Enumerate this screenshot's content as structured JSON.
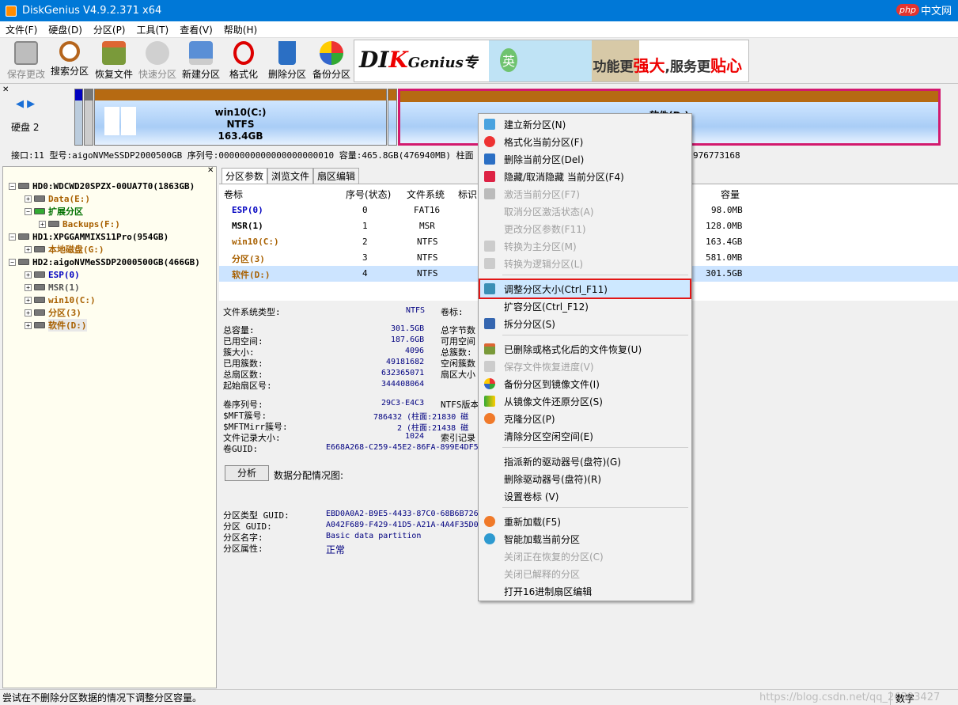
{
  "window": {
    "title": "DiskGenius V4.9.2.371 x64"
  },
  "watermark": {
    "php": "php",
    "cn": "中文网",
    "csdn": "https://blog.csdn.net/qq_26393427"
  },
  "menu": [
    "文件(F)",
    "硬盘(D)",
    "分区(P)",
    "工具(T)",
    "查看(V)",
    "帮助(H)"
  ],
  "toolbar": {
    "save": "保存更改",
    "search": "搜索分区",
    "recover": "恢复文件",
    "quick": "快速分区",
    "new": "新建分区",
    "format": "格式化",
    "delete": "删除分区",
    "backup": "备份分区"
  },
  "banner": {
    "logo_a": "DI",
    "logo_b": "K",
    "logo_c": "Genius",
    "logo_d": "专",
    "slogan_a": "功能更",
    "slogan_b": "强大",
    "slogan_c": ",服务更",
    "slogan_d": "贴心",
    "mascot": "英"
  },
  "diskbar": {
    "disk_label": "硬盘 2",
    "c_name": "win10(C:)",
    "c_fs": "NTFS",
    "c_size": "163.4GB",
    "d_name": "软件(D:)"
  },
  "infoline": "接口:11  型号:aigoNVMeSSDP2000500GB  序列号:0000000000000000000010  容量:465.8GB(476940MB)  柱面",
  "infoline_tail": "976773168",
  "tree": [
    {
      "label": "HD0:WDCWD20SPZX-00UA7T0(1863GB)",
      "cls": "c-disk"
    },
    {
      "label": "Data(E:)",
      "cls": "c-orange"
    },
    {
      "label": "扩展分区",
      "cls": "c-green"
    },
    {
      "label": "Backups(F:)",
      "cls": "c-orange"
    },
    {
      "label": "HD1:XPGGAMMIXS11Pro(954GB)",
      "cls": "c-disk"
    },
    {
      "label": "本地磁盘(G:)",
      "cls": "c-orange"
    },
    {
      "label": "HD2:aigoNVMeSSDP2000500GB(466GB)",
      "cls": "c-disk"
    },
    {
      "label": "ESP(0)",
      "cls": "c-blue"
    },
    {
      "label": "MSR(1)",
      "cls": "c-gray"
    },
    {
      "label": "win10(C:)",
      "cls": "c-orange"
    },
    {
      "label": "分区(3)",
      "cls": "c-orange"
    },
    {
      "label": "软件(D:)",
      "cls": "c-orange"
    }
  ],
  "tabs": [
    "分区参数",
    "浏览文件",
    "扇区编辑"
  ],
  "table": {
    "headers": [
      "卷标",
      "序号(状态)",
      "文件系统",
      "标识",
      "容量"
    ],
    "rows": [
      {
        "name": "ESP(0)",
        "idx": "0",
        "fs": "FAT16",
        "size": "98.0MB"
      },
      {
        "name": "MSR(1)",
        "idx": "1",
        "fs": "MSR",
        "size": "128.0MB"
      },
      {
        "name": "win10(C:)",
        "idx": "2",
        "fs": "NTFS",
        "size": "163.4GB"
      },
      {
        "name": "分区(3)",
        "idx": "3",
        "fs": "NTFS",
        "size": "581.0MB"
      },
      {
        "name": "软件(D:)",
        "idx": "4",
        "fs": "NTFS",
        "size": "301.5GB"
      }
    ]
  },
  "details": {
    "fs_type_label": "文件系统类型:",
    "fs_type": "NTFS",
    "vol_label": "卷标:",
    "total_label": "总容量:",
    "total": "301.5GB",
    "total_bytes_label": "总字节数",
    "used_label": "已用空间:",
    "used": "187.6GB",
    "free_label": "可用空间",
    "cluster_label": "簇大小:",
    "cluster": "4096",
    "total_clusters_label": "总簇数:",
    "used_clusters_label": "已用簇数:",
    "used_clusters": "49181682",
    "free_clusters_label": "空闲簇数",
    "sectors_label": "总扇区数:",
    "sectors": "632365071",
    "sector_size_label": "扇区大小",
    "start_label": "起始扇区号:",
    "start": "344408064",
    "serial_label": "卷序列号:",
    "serial": "29C3-E4C3",
    "ntfs_ver_label": "NTFS版本",
    "mft_label": "$MFT簇号:",
    "mft": "786432 (柱面:21830 磁",
    "mftmirr_label": "$MFTMirr簇号:",
    "mftmirr": "2 (柱面:21438 磁",
    "rec_label": "文件记录大小:",
    "rec": "1024",
    "index_label": "索引记录",
    "guid_label": "卷GUID:",
    "guid": "E668A268-C259-45E2-86FA-899E4DF5",
    "analyze": "分析",
    "dist_label": "数据分配情况图:",
    "ptype_label": "分区类型 GUID:",
    "ptype": "EBD0A0A2-B9E5-4433-87C0-68B6B726",
    "pguid_label": "分区 GUID:",
    "pguid": "A042F689-F429-41D5-A21A-4A4F35D0",
    "pname_label": "分区名字:",
    "pname": "Basic data partition",
    "pattr_label": "分区属性:",
    "pattr": "正常"
  },
  "context_menu": [
    "建立新分区(N)",
    "格式化当前分区(F)",
    "删除当前分区(Del)",
    "隐藏/取消隐藏 当前分区(F4)",
    "激活当前分区(F7)",
    "取消分区激活状态(A)",
    "更改分区参数(F11)",
    "转换为主分区(M)",
    "转换为逻辑分区(L)",
    "调整分区大小(Ctrl_F11)",
    "扩容分区(Ctrl_F12)",
    "拆分分区(S)",
    "已删除或格式化后的文件恢复(U)",
    "保存文件恢复进度(V)",
    "备份分区到镜像文件(I)",
    "从镜像文件还原分区(S)",
    "克隆分区(P)",
    "清除分区空闲空间(E)",
    "指派新的驱动器号(盘符)(G)",
    "删除驱动器号(盘符)(R)",
    "设置卷标 (V)",
    "重新加载(F5)",
    "智能加载当前分区",
    "关闭正在恢复的分区(C)",
    "关闭已解释的分区",
    "打开16进制扇区编辑"
  ],
  "status": {
    "text": "尝试在不删除分区数据的情况下调整分区容量。",
    "mode": "数字"
  }
}
